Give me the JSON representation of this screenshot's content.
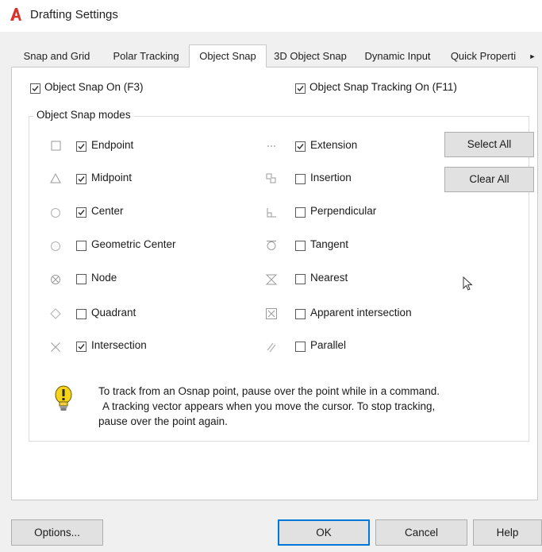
{
  "window": {
    "title": "Drafting Settings",
    "app_logo_color": "#d9322b"
  },
  "tabs": [
    {
      "label": "Snap and Grid",
      "active": false
    },
    {
      "label": "Polar Tracking",
      "active": false
    },
    {
      "label": "Object Snap",
      "active": true
    },
    {
      "label": "3D Object Snap",
      "active": false
    },
    {
      "label": "Dynamic Input",
      "active": false
    },
    {
      "label": "Quick Properti",
      "active": false
    }
  ],
  "top_options": {
    "object_snap_on": {
      "label": "Object Snap On (F3)",
      "checked": true
    },
    "object_snap_tracking_on": {
      "label": "Object Snap Tracking On (F11)",
      "checked": true
    }
  },
  "modes_group": {
    "title": "Object Snap modes",
    "left_column": [
      {
        "label": "Endpoint",
        "checked": true,
        "icon": "endpoint-icon"
      },
      {
        "label": "Midpoint",
        "checked": true,
        "icon": "midpoint-icon"
      },
      {
        "label": "Center",
        "checked": true,
        "icon": "center-icon"
      },
      {
        "label": "Geometric Center",
        "checked": false,
        "icon": "geometric-center-icon"
      },
      {
        "label": "Node",
        "checked": false,
        "icon": "node-icon"
      },
      {
        "label": "Quadrant",
        "checked": false,
        "icon": "quadrant-icon"
      },
      {
        "label": "Intersection",
        "checked": true,
        "icon": "intersection-icon"
      }
    ],
    "right_column": [
      {
        "label": "Extension",
        "checked": true,
        "icon": "extension-icon"
      },
      {
        "label": "Insertion",
        "checked": false,
        "icon": "insertion-icon"
      },
      {
        "label": "Perpendicular",
        "checked": false,
        "icon": "perpendicular-icon"
      },
      {
        "label": "Tangent",
        "checked": false,
        "icon": "tangent-icon"
      },
      {
        "label": "Nearest",
        "checked": false,
        "icon": "nearest-icon"
      },
      {
        "label": "Apparent intersection",
        "checked": false,
        "icon": "apparent-intersection-icon"
      },
      {
        "label": "Parallel",
        "checked": false,
        "icon": "parallel-icon"
      }
    ],
    "select_all_label": "Select All",
    "clear_all_label": "Clear All"
  },
  "info": {
    "icon": "lightbulb-icon",
    "lines": [
      "To track from an Osnap point, pause over the point while in a command.",
      "A tracking vector appears when you move the cursor.  To stop tracking,",
      "pause over the point again."
    ]
  },
  "footer": {
    "options_label": "Options...",
    "ok_label": "OK",
    "cancel_label": "Cancel",
    "help_label": "Help"
  },
  "colors": {
    "check_mark": "#2b2b2b",
    "snap_icon_gray": "#9a9a9a",
    "default_button_border": "#0078d7",
    "bulb_yellow": "#f5d31a"
  }
}
